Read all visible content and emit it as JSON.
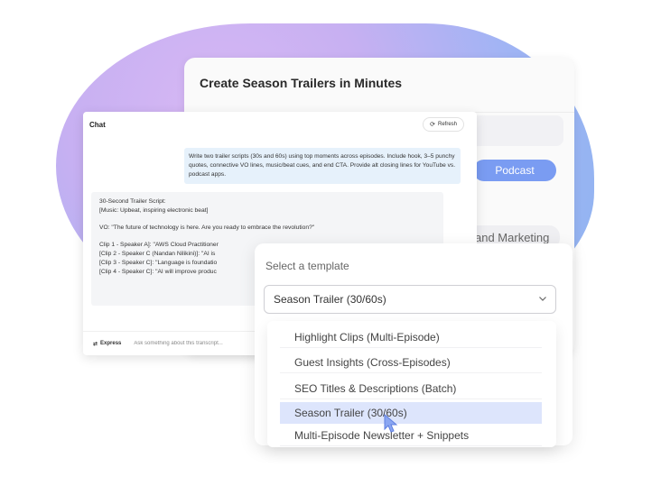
{
  "back_card": {
    "title": "Create Season Trailers in Minutes",
    "podcast_label": "Podcast",
    "chip_label": "and Marketing"
  },
  "chat": {
    "title": "Chat",
    "refresh_label": "Refresh",
    "user_message": "Write two trailer scripts (30s and 60s) using top moments across episodes. Include hook, 3–5 punchy quotes, connective VO lines, music/beat cues, and end CTA. Provide alt closing lines for YouTube vs. podcast apps.",
    "assistant_lines": [
      "30-Second Trailer Script:",
      "[Music: Upbeat, inspiring electronic beat]",
      "",
      "VO: \"The future of technology is here. Are you ready to embrace the revolution?\"",
      "",
      "Clip 1 - Speaker A]: \"AWS Cloud Practitioner",
      "[Clip 2 - Speaker C (Nandan Nilikini)]: \"AI is",
      "[Clip 3 - Speaker C]: \"Language is foundatio",
      "[Clip 4 - Speaker C]: \"AI will improve produc"
    ],
    "express_label": "Express",
    "input_placeholder": "Ask something about this transcript..."
  },
  "template_picker": {
    "label": "Select a template",
    "selected_value": "Season Trailer (30/60s)",
    "options": [
      "Highlight Clips (Multi-Episode)",
      "Guest Insights (Cross-Episodes)",
      "SEO Titles & Descriptions (Batch)",
      "Season Trailer (30/60s)",
      "Multi-Episode Newsletter + Snippets"
    ],
    "highlighted_index": 3
  },
  "colors": {
    "accent": "#7a9cf2",
    "highlight": "#dde5fc",
    "blob_start": "#d7b8f4",
    "blob_end": "#8fb4f0"
  }
}
